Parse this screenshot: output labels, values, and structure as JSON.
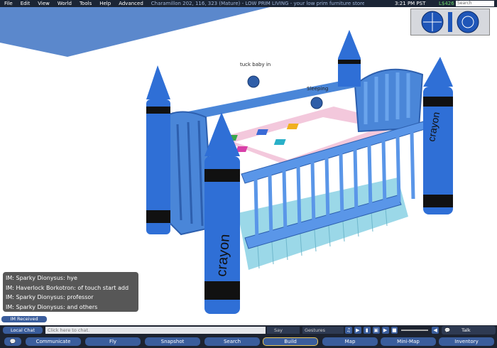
{
  "menu": {
    "items": [
      "File",
      "Edit",
      "View",
      "World",
      "Tools",
      "Help",
      "Advanced"
    ],
    "region": "Charamillon 202, 116, 323 (Mature) - LOW PRIM LIVING - your low prim furniture store!",
    "clock": "3:21 PM PST",
    "balance": "L$426",
    "search_placeholder": "Search"
  },
  "scene": {
    "touch_label": "tuck baby in",
    "status_label": "Sleeping",
    "crayon_text": "crayon"
  },
  "chat_history": [
    "IM: Sparky Dionysus: hye",
    "IM: Haverlock Borkotron: of touch  start  add",
    "IM: Sparky Dionysus: professor",
    "IM: Sparky Dionysus: and others"
  ],
  "chatbar": {
    "im_received": "IM Received",
    "local_chat": "Local Chat",
    "input_placeholder": "Click here to chat.",
    "say": "Say",
    "gestures": "Gestures",
    "talk": "Talk"
  },
  "toolbar": {
    "communicate": "Communicate",
    "fly": "Fly",
    "snapshot": "Snapshot",
    "search": "Search",
    "build": "Build",
    "map": "Map",
    "minimap": "Mini-Map",
    "inventory": "Inventory"
  },
  "colors": {
    "crayon_blue": "#2f6fd6",
    "sky": "#5b88cc",
    "ui_button": "#3a5d9c",
    "ui_bar": "#1d2330"
  }
}
